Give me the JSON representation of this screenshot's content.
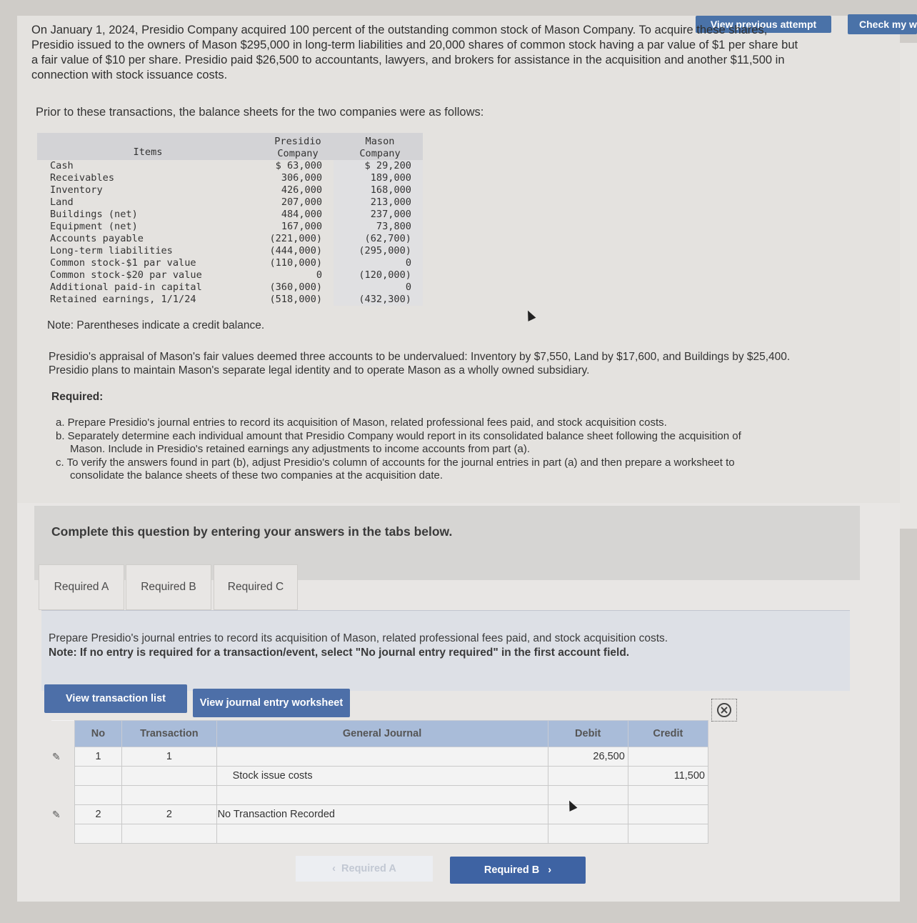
{
  "header": {
    "view_previous_label": "View previous attempt",
    "check_my_label": "Check my w"
  },
  "problem": {
    "intro": "On January 1, 2024, Presidio Company acquired 100 percent of the outstanding common stock of Mason Company. To acquire these shares, Presidio issued to the owners of Mason $295,000 in long-term liabilities and 20,000 shares of common stock having a par value of $1 per share but a fair value of $10 per share. Presidio paid $26,500 to accountants, lawyers, and brokers for assistance in the acquisition and another $11,500 in connection with stock issuance costs.",
    "prior": "Prior to these transactions, the balance sheets for the two companies were as follows:",
    "note": "Note: Parentheses indicate a credit balance.",
    "appraisal": "Presidio's appraisal of Mason's fair values deemed three accounts to be undervalued: Inventory by $7,550, Land by $17,600, and Buildings by $25,400. Presidio plans to maintain Mason's separate legal identity and to operate Mason as a wholly owned subsidiary.",
    "required_title": "Required:",
    "required_items": [
      "a. Prepare Presidio's journal entries to record its acquisition of Mason, related professional fees paid, and stock acquisition costs.",
      "b. Separately determine each individual amount that Presidio Company would report in its consolidated balance sheet following the acquisition of Mason. Include in Presidio's retained earnings any adjustments to income accounts from part (a).",
      "c. To verify the answers found in part (b), adjust Presidio's column of accounts for the journal entries in part (a) and then prepare a worksheet to consolidate the balance sheets of these two companies at the acquisition date."
    ]
  },
  "balance_sheet": {
    "header_items": "Items",
    "header_presidio_1": "Presidio",
    "header_presidio_2": "Company",
    "header_mason_1": "Mason",
    "header_mason_2": "Company",
    "rows": [
      {
        "item": "Cash",
        "presidio": "$ 63,000",
        "mason": "$ 29,200"
      },
      {
        "item": "Receivables",
        "presidio": "306,000",
        "mason": "189,000"
      },
      {
        "item": "Inventory",
        "presidio": "426,000",
        "mason": "168,000"
      },
      {
        "item": "Land",
        "presidio": "207,000",
        "mason": "213,000"
      },
      {
        "item": "Buildings (net)",
        "presidio": "484,000",
        "mason": "237,000"
      },
      {
        "item": "Equipment (net)",
        "presidio": "167,000",
        "mason": "73,800"
      },
      {
        "item": "Accounts payable",
        "presidio": "(221,000)",
        "mason": "(62,700)"
      },
      {
        "item": "Long-term liabilities",
        "presidio": "(444,000)",
        "mason": "(295,000)"
      },
      {
        "item": "Common stock-$1 par value",
        "presidio": "(110,000)",
        "mason": "0"
      },
      {
        "item": "Common stock-$20 par value",
        "presidio": "0",
        "mason": "(120,000)"
      },
      {
        "item": "Additional paid-in capital",
        "presidio": "(360,000)",
        "mason": "0"
      },
      {
        "item": "Retained earnings, 1/1/24",
        "presidio": "(518,000)",
        "mason": "(432,300)"
      }
    ]
  },
  "answer_area": {
    "complete_prompt": "Complete this question by entering your answers in the tabs below.",
    "tabs": [
      "Required A",
      "Required B",
      "Required C"
    ],
    "instruction": "Prepare Presidio's journal entries to record its acquisition of Mason, related professional fees paid, and stock acquisition costs.",
    "note": "Note: If no entry is required for a transaction/event, select \"No journal entry required\" in the first account field.",
    "view_transaction_list": "View transaction list",
    "view_journal_worksheet": "View journal entry worksheet"
  },
  "journal": {
    "headers": {
      "no": "No",
      "transaction": "Transaction",
      "general_journal": "General Journal",
      "debit": "Debit",
      "credit": "Credit"
    },
    "rows": [
      {
        "no": "1",
        "transaction": "1",
        "account": "",
        "debit": "26,500",
        "credit": ""
      },
      {
        "no": "",
        "transaction": "",
        "account": "Stock issue costs",
        "debit": "",
        "credit": "11,500"
      },
      {
        "no": "",
        "transaction": "",
        "account": "",
        "debit": "",
        "credit": ""
      },
      {
        "no": "2",
        "transaction": "2",
        "account": "No Transaction Recorded",
        "debit": "",
        "credit": ""
      },
      {
        "no": "",
        "transaction": "",
        "account": "",
        "debit": "",
        "credit": ""
      }
    ]
  },
  "navigation": {
    "prev_label": "Required A",
    "next_label": "Required B"
  }
}
